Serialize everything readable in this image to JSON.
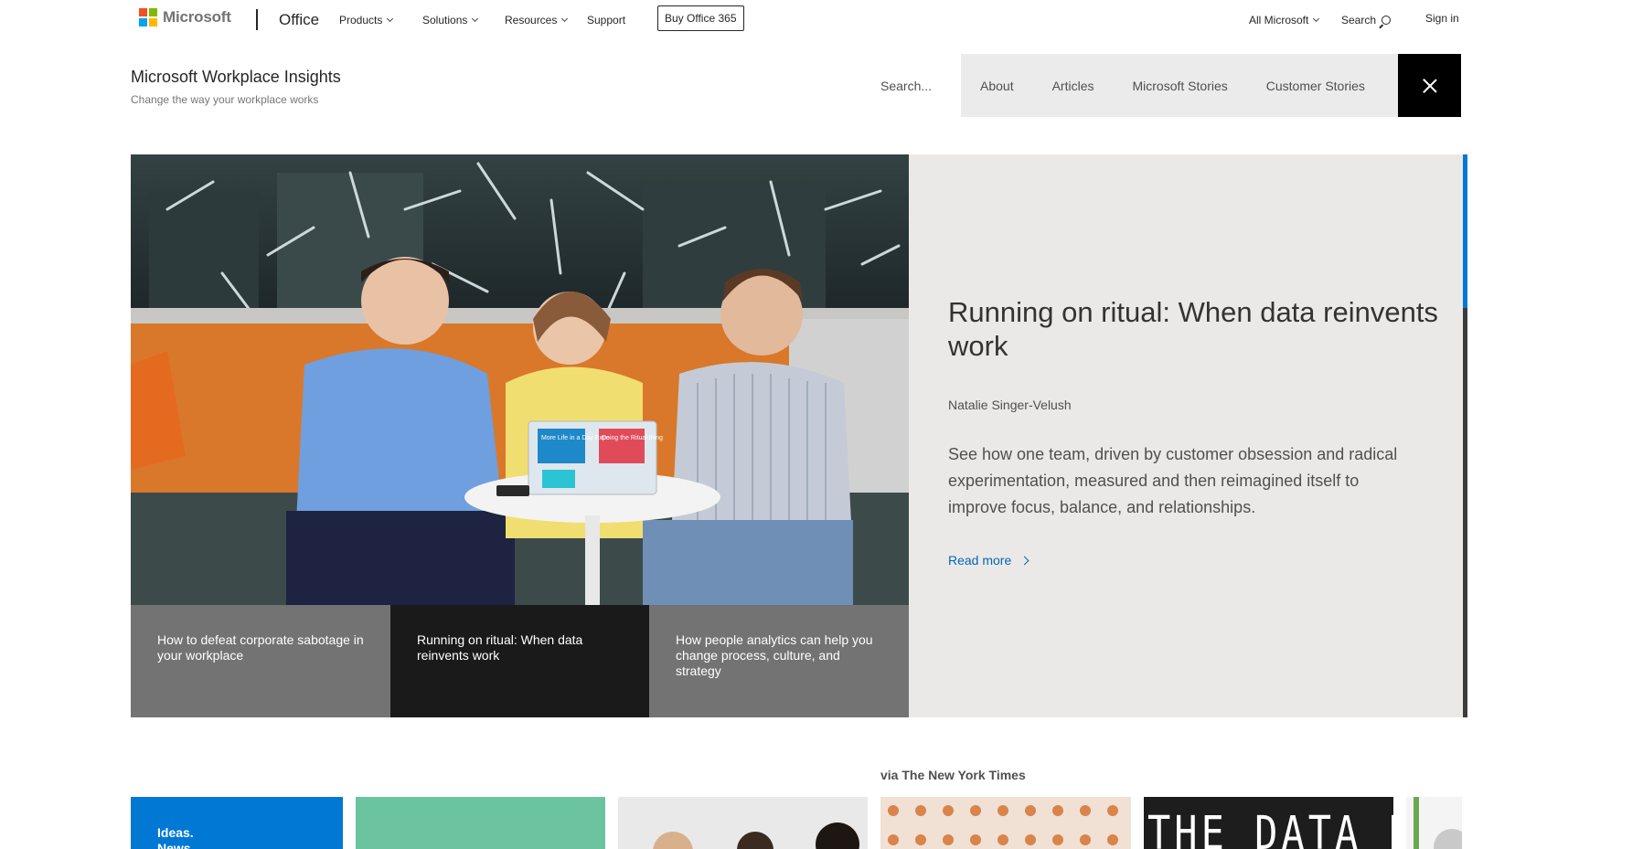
{
  "global_nav": {
    "brand": "Microsoft",
    "product": "Office",
    "items": [
      {
        "label": "Products"
      },
      {
        "label": "Solutions"
      },
      {
        "label": "Resources"
      },
      {
        "label": "Support"
      }
    ],
    "buy_button": "Buy Office 365",
    "all_microsoft": "All Microsoft",
    "search": "Search",
    "sign_in": "Sign in",
    "logo_colors": [
      "#f25022",
      "#7fba00",
      "#00a4ef",
      "#ffb900"
    ]
  },
  "site_header": {
    "title": "Microsoft Workplace Insights",
    "subtitle": "Change the way your workplace works",
    "search_placeholder": "Search...",
    "nav": [
      {
        "label": "About"
      },
      {
        "label": "Articles"
      },
      {
        "label": "Microsoft Stories"
      },
      {
        "label": "Customer Stories"
      }
    ]
  },
  "hero": {
    "title": "Running on ritual: When data reinvents work",
    "author": "Natalie Singer-Velush",
    "description": "See how one team, driven by customer obsession and radical experimentation, measured and then reimagined itself to improve focus, balance, and relationships.",
    "read_more": "Read more",
    "accent_color": "#0078d4",
    "tabs": [
      {
        "label": "How to defeat corporate sabotage in your workplace",
        "active": false
      },
      {
        "label": "Running on ritual: When data reinvents work",
        "active": true
      },
      {
        "label": "How people analytics can help you change process, culture, and strategy",
        "active": false
      }
    ],
    "laptop_text": [
      "More Life in a Day Expe",
      "Doing the Ritual thing"
    ]
  },
  "feed": {
    "via_label": "via The New York Times",
    "ideas_card": [
      "Ideas.",
      "News."
    ],
    "data_card_text": "THE DATA BINGE"
  }
}
